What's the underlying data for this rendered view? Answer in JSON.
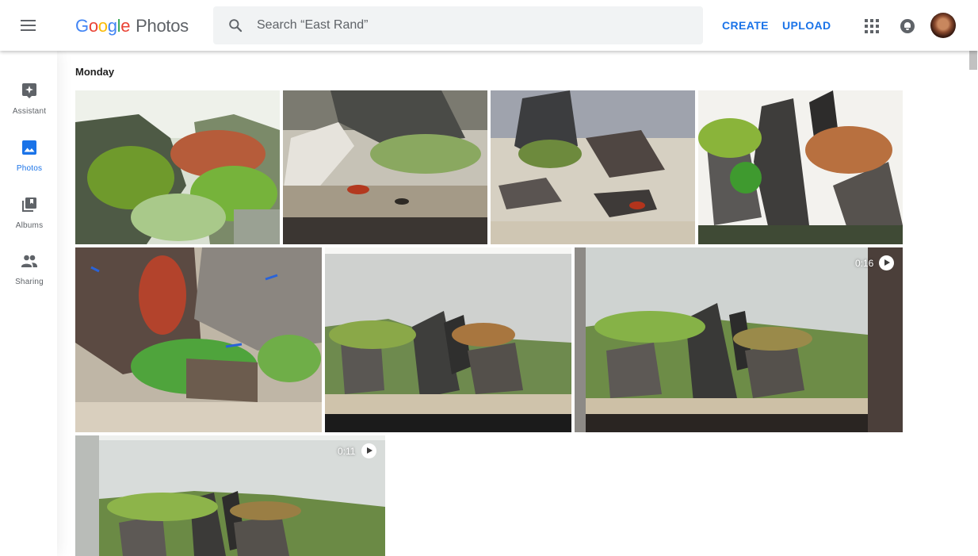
{
  "app": {
    "logo_letters": [
      "G",
      "o",
      "o",
      "g",
      "l",
      "e"
    ],
    "logo_product": "Photos"
  },
  "search": {
    "placeholder": "Search “East Rand”"
  },
  "header": {
    "create_label": "CREATE",
    "upload_label": "UPLOAD"
  },
  "sidebar": {
    "items": [
      {
        "label": "Assistant",
        "icon": "assistant-icon",
        "active": false
      },
      {
        "label": "Photos",
        "icon": "photos-icon",
        "active": true
      },
      {
        "label": "Albums",
        "icon": "albums-icon",
        "active": false
      },
      {
        "label": "Sharing",
        "icon": "sharing-icon",
        "active": false
      }
    ]
  },
  "content": {
    "date_heading": "Monday",
    "photos": [
      {
        "kind": "photo",
        "subject": "aquarium-plants-closeup"
      },
      {
        "kind": "photo",
        "subject": "shrimp-on-gravel"
      },
      {
        "kind": "photo",
        "subject": "rocks-and-shrimp"
      },
      {
        "kind": "photo",
        "subject": "rock-scape-closeup"
      },
      {
        "kind": "photo",
        "subject": "fish-and-clover"
      },
      {
        "kind": "photo",
        "subject": "tank-front-view"
      },
      {
        "kind": "video",
        "subject": "tank-wide-view",
        "duration": "0:16"
      },
      {
        "kind": "video",
        "subject": "tank-side-view",
        "duration": "0:11"
      }
    ]
  },
  "colors": {
    "accent": "#1a73e8",
    "icon_gray": "#5f6368",
    "search_bg": "#f1f3f4"
  }
}
